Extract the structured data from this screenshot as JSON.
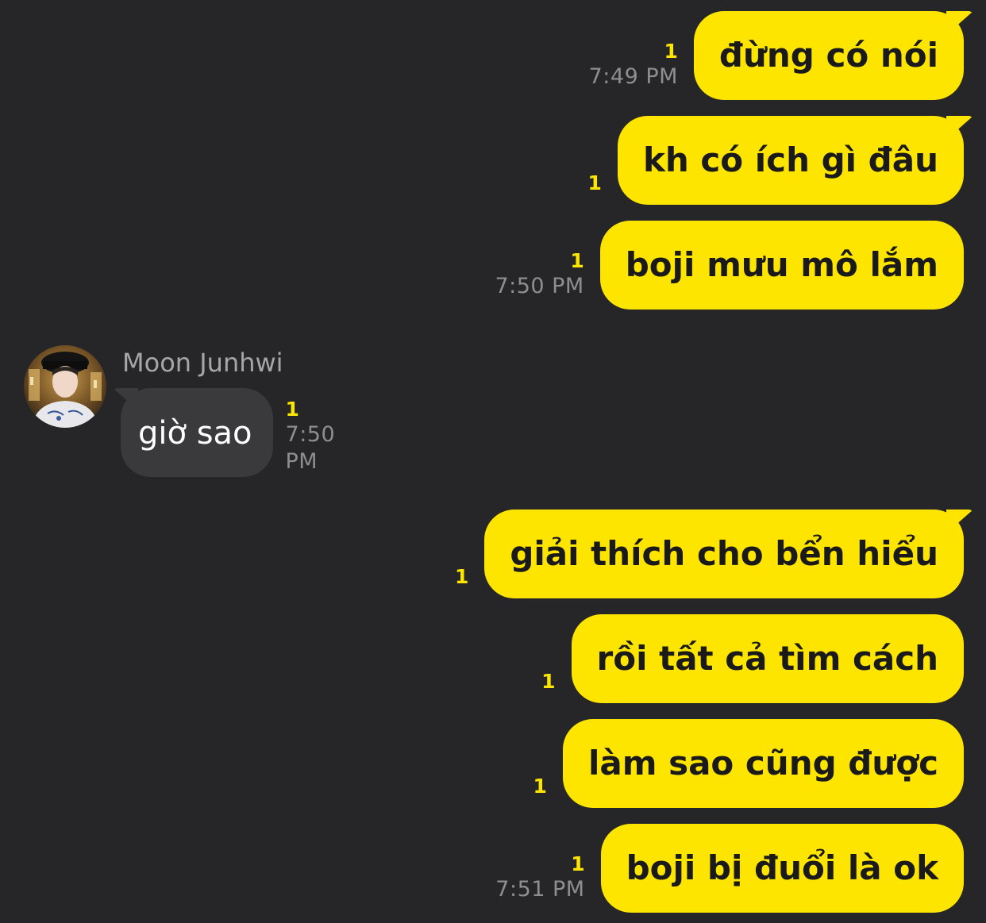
{
  "theme": {
    "background": "#262628",
    "outgoing_bubble": "#fee500",
    "incoming_bubble": "#3a3a3c",
    "unread_color": "#fee500",
    "time_color": "#8e8e90"
  },
  "messages_top": [
    {
      "text": "đừng có nói",
      "unread": "1",
      "time": "7:49 PM"
    },
    {
      "text": "kh có ích gì đâu",
      "unread": "1",
      "time": ""
    },
    {
      "text": "boji mưu mô lắm",
      "unread": "1",
      "time": "7:50 PM"
    }
  ],
  "incoming": {
    "sender": "Moon Junhwi",
    "avatar_icon": "profile-photo",
    "text": "giờ sao",
    "unread": "1",
    "time": "7:50 PM"
  },
  "messages_bottom": [
    {
      "text": "giải thích cho bển hiểu",
      "unread": "1",
      "time": ""
    },
    {
      "text": "rồi tất cả tìm cách",
      "unread": "1",
      "time": ""
    },
    {
      "text": "làm sao cũng được",
      "unread": "1",
      "time": ""
    },
    {
      "text": "boji bị đuổi là ok",
      "unread": "1",
      "time": "7:51 PM"
    }
  ]
}
